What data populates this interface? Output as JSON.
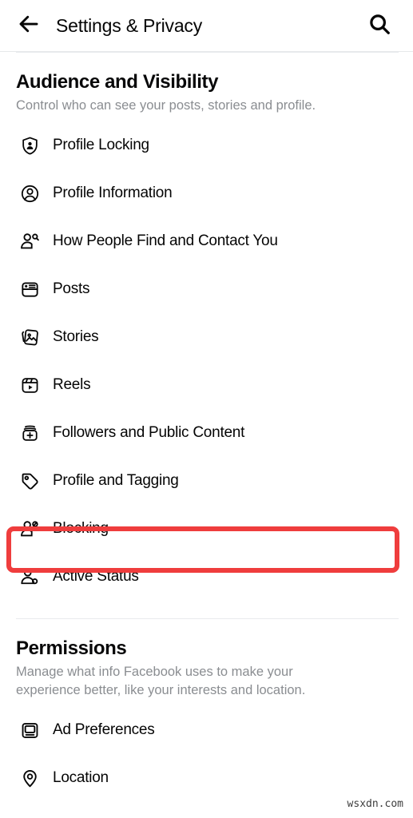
{
  "header": {
    "back_icon": "arrow-left-icon",
    "title": "Settings & Privacy",
    "search_icon": "search-icon"
  },
  "sections": [
    {
      "id": "audience-and-visibility",
      "title": "Audience and Visibility",
      "subtitle": "Control who can see your posts, stories and profile.",
      "items": [
        {
          "label": "Profile Locking",
          "icon": "shield-person-icon"
        },
        {
          "label": "Profile Information",
          "icon": "person-circle-icon"
        },
        {
          "label": "How People Find and Contact You",
          "icon": "person-search-icon"
        },
        {
          "label": "Posts",
          "icon": "post-card-icon"
        },
        {
          "label": "Stories",
          "icon": "photo-stack-icon"
        },
        {
          "label": "Reels",
          "icon": "reels-play-icon"
        },
        {
          "label": "Followers and Public Content",
          "icon": "add-follower-icon"
        },
        {
          "label": "Profile and Tagging",
          "icon": "tag-icon"
        },
        {
          "label": "Blocking",
          "icon": "person-block-icon",
          "highlighted": true
        },
        {
          "label": "Active Status",
          "icon": "person-active-icon"
        }
      ]
    },
    {
      "id": "permissions",
      "title": "Permissions",
      "subtitle": "Manage what info Facebook uses to make your experience better, like your interests and location.",
      "items": [
        {
          "label": "Ad Preferences",
          "icon": "monitor-icon"
        },
        {
          "label": "Location",
          "icon": "location-pin-icon"
        }
      ]
    }
  ],
  "annotation": {
    "highlight_color": "#ef3d3d",
    "highlight_target": "Blocking"
  },
  "watermark": {
    "text": "wsxdn.com"
  }
}
